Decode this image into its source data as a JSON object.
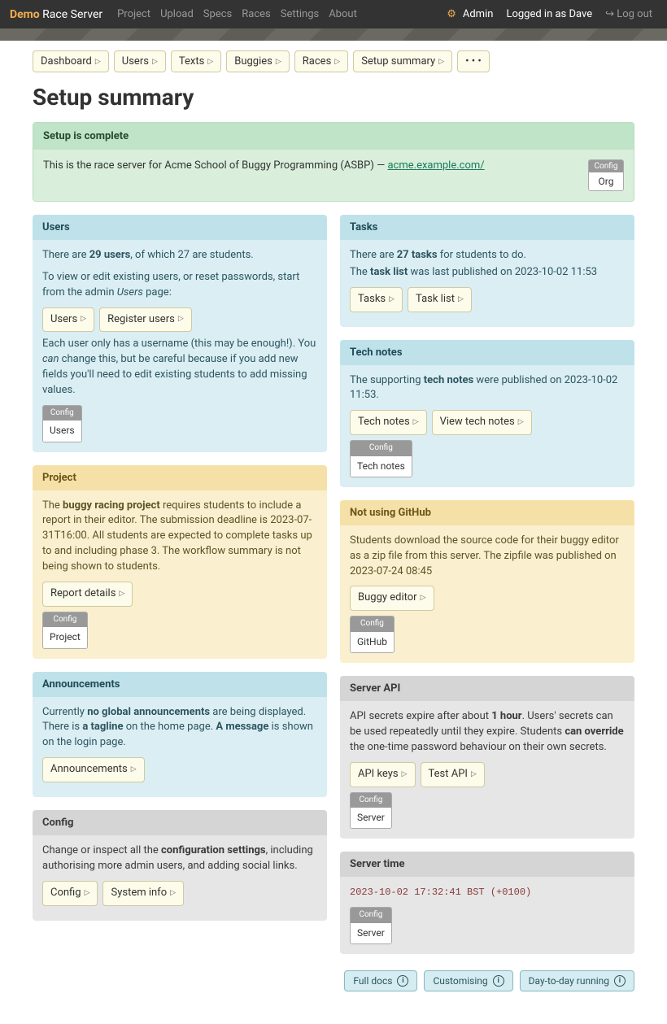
{
  "nav": {
    "brand_demo": "Demo",
    "brand_rest": " Race Server",
    "links": [
      "Project",
      "Upload",
      "Specs",
      "Races",
      "Settings",
      "About"
    ],
    "admin": "Admin",
    "loggedin": "Logged in as Dave",
    "logout": "Log out"
  },
  "pills": [
    "Dashboard",
    "Users",
    "Texts",
    "Buggies",
    "Races",
    "Setup summary"
  ],
  "more": "• • •",
  "page_title": "Setup summary",
  "complete": {
    "title": "Setup is complete",
    "desc": "This is the race server for Acme School of Buggy Programming (ASBP) — ",
    "link": "acme.example.com/",
    "config_label": "Config",
    "config_value": "Org"
  },
  "cards": {
    "users": {
      "title": "Users",
      "p1a": "There are ",
      "p1b": "29 users",
      "p1c": ", of which 27 are students.",
      "p2a": "To view or edit existing users, or reset passwords, start from the admin ",
      "p2b": "Users",
      "p2c": " page:",
      "btns": [
        "Users",
        "Register users"
      ],
      "p3a": "Each user only has a username (this may be enough!). You ",
      "p3b": "can",
      "p3c": " change this, but be careful because if you add new fields you'll need to edit existing students to add missing values.",
      "config": "Users"
    },
    "tasks": {
      "title": "Tasks",
      "p1a": "There are ",
      "p1b": "27 tasks",
      "p1c": " for students to do.",
      "p2a": "The ",
      "p2b": "task list",
      "p2c": " was last published on 2023-10-02 11:53",
      "btns": [
        "Tasks",
        "Task list"
      ]
    },
    "technotes": {
      "title": "Tech notes",
      "p1a": "The supporting ",
      "p1b": "tech notes",
      "p1c": " were published on 2023-10-02 11:53.",
      "btns": [
        "Tech notes",
        "View tech notes"
      ],
      "config": "Tech notes"
    },
    "project": {
      "title": "Project",
      "p1a": "The ",
      "p1b": "buggy racing project",
      "p1c": " requires students to include a report in their editor. The submission deadline is 2023-07-31T16:00. All students are expected to complete tasks up to and including phase 3. The workflow summary is not being shown to students.",
      "btns": [
        "Report details"
      ],
      "config": "Project"
    },
    "github": {
      "title": "Not using GitHub",
      "p1": "Students download the source code for their buggy editor as a zip file from this server. The zipfile was published on 2023-07-24 08:45",
      "btns": [
        "Buggy editor"
      ],
      "config": "GitHub"
    },
    "announcements": {
      "title": "Announcements",
      "p1a": "Currently ",
      "p1b": "no global announcements",
      "p1c": " are being displayed. There is ",
      "p1d": "a tagline",
      "p1e": " on the home page. ",
      "p1f": "A message",
      "p1g": " is shown on the login page.",
      "btns": [
        "Announcements"
      ]
    },
    "serverapi": {
      "title": "Server API",
      "p1a": "API secrets expire after about ",
      "p1b": "1 hour",
      "p1c": ". Users' secrets can be used repeatedly until they expire. Students ",
      "p1d": "can override",
      "p1e": " the one-time password behaviour on their own secrets.",
      "btns": [
        "API keys",
        "Test API"
      ],
      "config": "Server"
    },
    "config": {
      "title": "Config",
      "p1a": "Change or inspect all the ",
      "p1b": "configuration settings",
      "p1c": ", including authorising more admin users, and adding social links.",
      "btns": [
        "Config",
        "System info"
      ]
    },
    "servertime": {
      "title": "Server time",
      "time": "2023-10-02 17:32:41 BST (+0100)",
      "config": "Server"
    }
  },
  "config_label": "Config",
  "footer": [
    "Full docs",
    "Customising",
    "Day-to-day running"
  ]
}
